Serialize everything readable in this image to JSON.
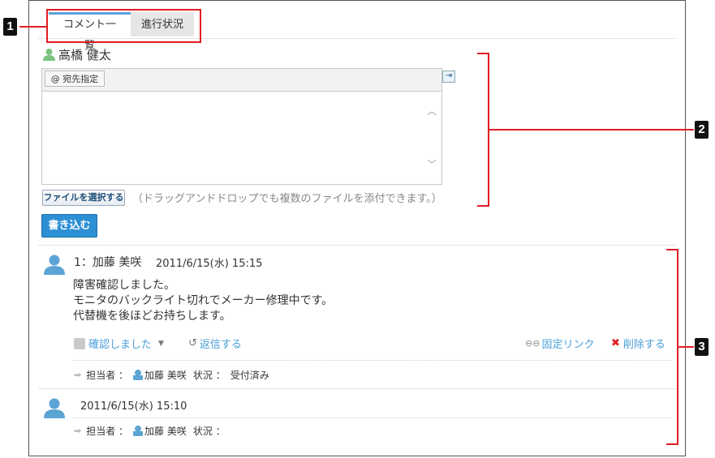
{
  "tabs": [
    {
      "label": "コメント一覧"
    },
    {
      "label": "進行状況"
    }
  ],
  "callouts": [
    "1",
    "2",
    "3"
  ],
  "editor": {
    "user_name": "高橋 健太",
    "mention_label": "@ 宛先指定",
    "file_button": "ファイルを選択する",
    "file_hint": "（ドラッグアンドドロップでも複数のファイルを添付できます。）",
    "submit_label": "書き込む"
  },
  "comments": [
    {
      "header": "1：加藤 美咲",
      "date": "2011/6/15(水) 15:15",
      "lines": [
        "障害確認しました。",
        "モニタのバックライト切れでメーカー修理中です。",
        "代替機を後ほどお持ちします。"
      ],
      "actions": {
        "confirm": "確認しました",
        "reply": "返信する",
        "permalink": "固定リンク",
        "delete": "削除する"
      },
      "meta": {
        "assignee_label": "担当者 ：",
        "assignee": "加藤 美咲",
        "status_label": "状況 ：",
        "status": "受付済み"
      }
    },
    {
      "date": "2011/6/15(水) 15:10",
      "meta": {
        "assignee_label": "担当者 ：",
        "assignee": "加藤 美咲",
        "status_label": "状況 ："
      }
    }
  ],
  "colors": {
    "accent": "#2d8fd4",
    "link": "#4a9fd8",
    "callout": "#e01c24",
    "avatar": "#5ba4d4"
  }
}
